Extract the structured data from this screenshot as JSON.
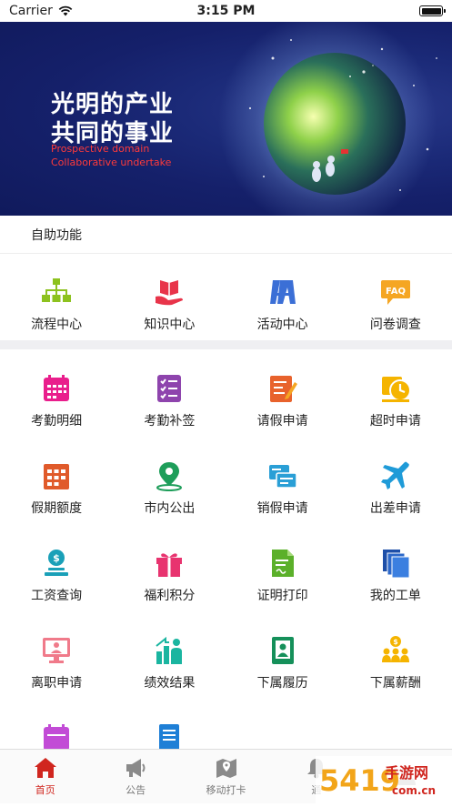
{
  "status_bar": {
    "carrier": "Carrier",
    "time": "3:15 PM"
  },
  "banner": {
    "title_line1": "光明的产业",
    "title_line2": "共同的事业",
    "sub_line1": "Prospective domain",
    "sub_line2": "Collaborative undertake"
  },
  "section": {
    "title": "自助功能"
  },
  "quick_items": [
    {
      "label": "流程中心",
      "icon": "flowchart-icon"
    },
    {
      "label": "知识中心",
      "icon": "book-hand-icon"
    },
    {
      "label": "活动中心",
      "icon": "easel-icon"
    },
    {
      "label": "问卷调查",
      "icon": "faq-icon"
    }
  ],
  "grid_items": [
    {
      "label": "考勤明细",
      "icon": "calendar-icon"
    },
    {
      "label": "考勤补签",
      "icon": "checklist-icon"
    },
    {
      "label": "请假申请",
      "icon": "leave-form-icon"
    },
    {
      "label": "超时申请",
      "icon": "overtime-clock-icon"
    },
    {
      "label": "假期额度",
      "icon": "holiday-calendar-icon"
    },
    {
      "label": "市内公出",
      "icon": "map-pin-icon"
    },
    {
      "label": "销假申请",
      "icon": "cancel-leave-icon"
    },
    {
      "label": "出差申请",
      "icon": "airplane-icon"
    },
    {
      "label": "工资查询",
      "icon": "salary-coin-icon"
    },
    {
      "label": "福利积分",
      "icon": "gift-icon"
    },
    {
      "label": "证明打印",
      "icon": "certificate-icon"
    },
    {
      "label": "我的工单",
      "icon": "documents-icon"
    },
    {
      "label": "离职申请",
      "icon": "resign-monitor-icon"
    },
    {
      "label": "绩效结果",
      "icon": "performance-icon"
    },
    {
      "label": "下属履历",
      "icon": "resume-icon"
    },
    {
      "label": "下属薪酬",
      "icon": "team-salary-icon"
    },
    {
      "label": "",
      "icon": "calendar-partial-icon"
    },
    {
      "label": "",
      "icon": "notebook-partial-icon"
    }
  ],
  "tabbar": [
    {
      "label": "首页",
      "icon": "home-icon",
      "active": true
    },
    {
      "label": "公告",
      "icon": "megaphone-icon",
      "active": false
    },
    {
      "label": "移动打卡",
      "icon": "map-checkin-icon",
      "active": false
    },
    {
      "label": "通",
      "icon": "bell-icon",
      "active": false
    },
    {
      "label": "",
      "icon": "person-icon",
      "active": false
    }
  ],
  "watermark": {
    "text": "手游网",
    "domain": "com.cn",
    "logo_text": "5419"
  },
  "colors": {
    "accent": "#d0261f",
    "banner_bg": "#16226b",
    "divider": "#efeff2"
  }
}
